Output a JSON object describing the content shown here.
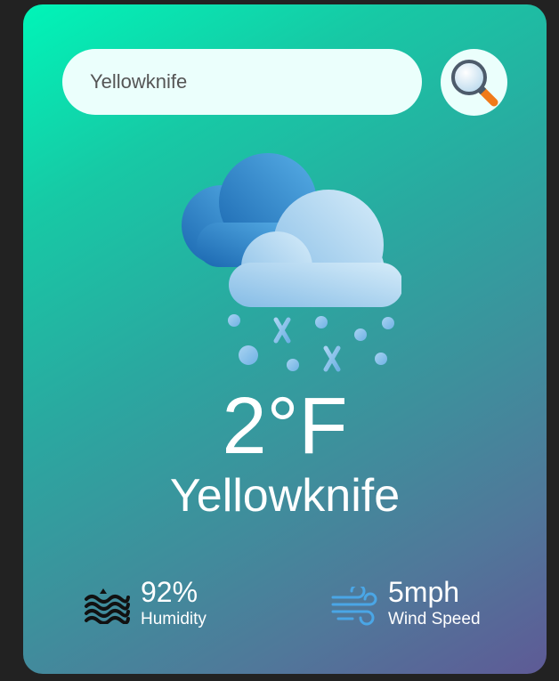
{
  "search": {
    "value": "Yellowknife",
    "icon": "magnifier-icon"
  },
  "weather": {
    "icon": "snow-cloud-icon",
    "temperature": "2°F",
    "city": "Yellowknife"
  },
  "humidity": {
    "value": "92%",
    "label": "Humidity",
    "icon": "humidity-waves-icon"
  },
  "wind": {
    "value": "5mph",
    "label": "Wind Speed",
    "icon": "wind-icon"
  },
  "colors": {
    "background": "#222222",
    "card_gradient_start": "#00f5b8",
    "card_gradient_end": "#5e5a96",
    "input_bg": "#ebfffc",
    "text": "#ffffff"
  }
}
